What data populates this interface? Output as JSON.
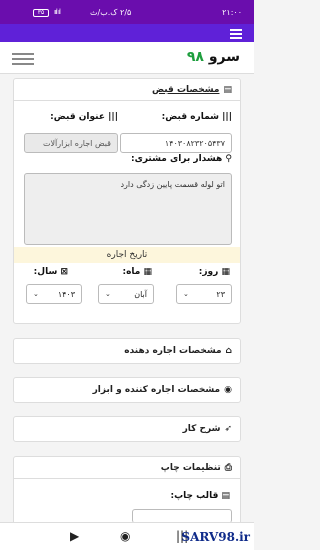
{
  "statusbar": {
    "time": "۲۱:۰۰",
    "right_text": "۲/۵ ک.ب/ث",
    "battery": "۳۵",
    "signal": "ııl ıl"
  },
  "navbar": {
    "logo_text": "سرو",
    "logo_num": "۹۸"
  },
  "invoice_section": {
    "title": "مشخصات قبض",
    "invoice_number_label": "شماره قبض:",
    "invoice_number_value": "۱۴۰۳۰۸۲۳۲۰۵۴۳۷",
    "invoice_title_label": "عنوان قبض:",
    "invoice_title_value": "قبض اجاره ابزارآلات",
    "warning_label": "هشدار برای مشتری:",
    "warning_value": "اتو لوله قسمت پایین زدگی دارد",
    "rent_date_title": "تاریخ اجاره",
    "day_label": "روز:",
    "day_value": "۲۳",
    "month_label": "ماه:",
    "month_value": "آبان",
    "year_label": "سال:",
    "year_value": "۱۴۰۳"
  },
  "sections": {
    "renter_giver": "مشخصات اجاره دهنده",
    "renter_taker": "مشخصات اجاره کننده و ابزار",
    "job_desc": "شرح کار",
    "print_settings": "تنظیمات چاپ",
    "print_template_label": "قالب چاپ:"
  },
  "watermark": "SARV98.ir"
}
